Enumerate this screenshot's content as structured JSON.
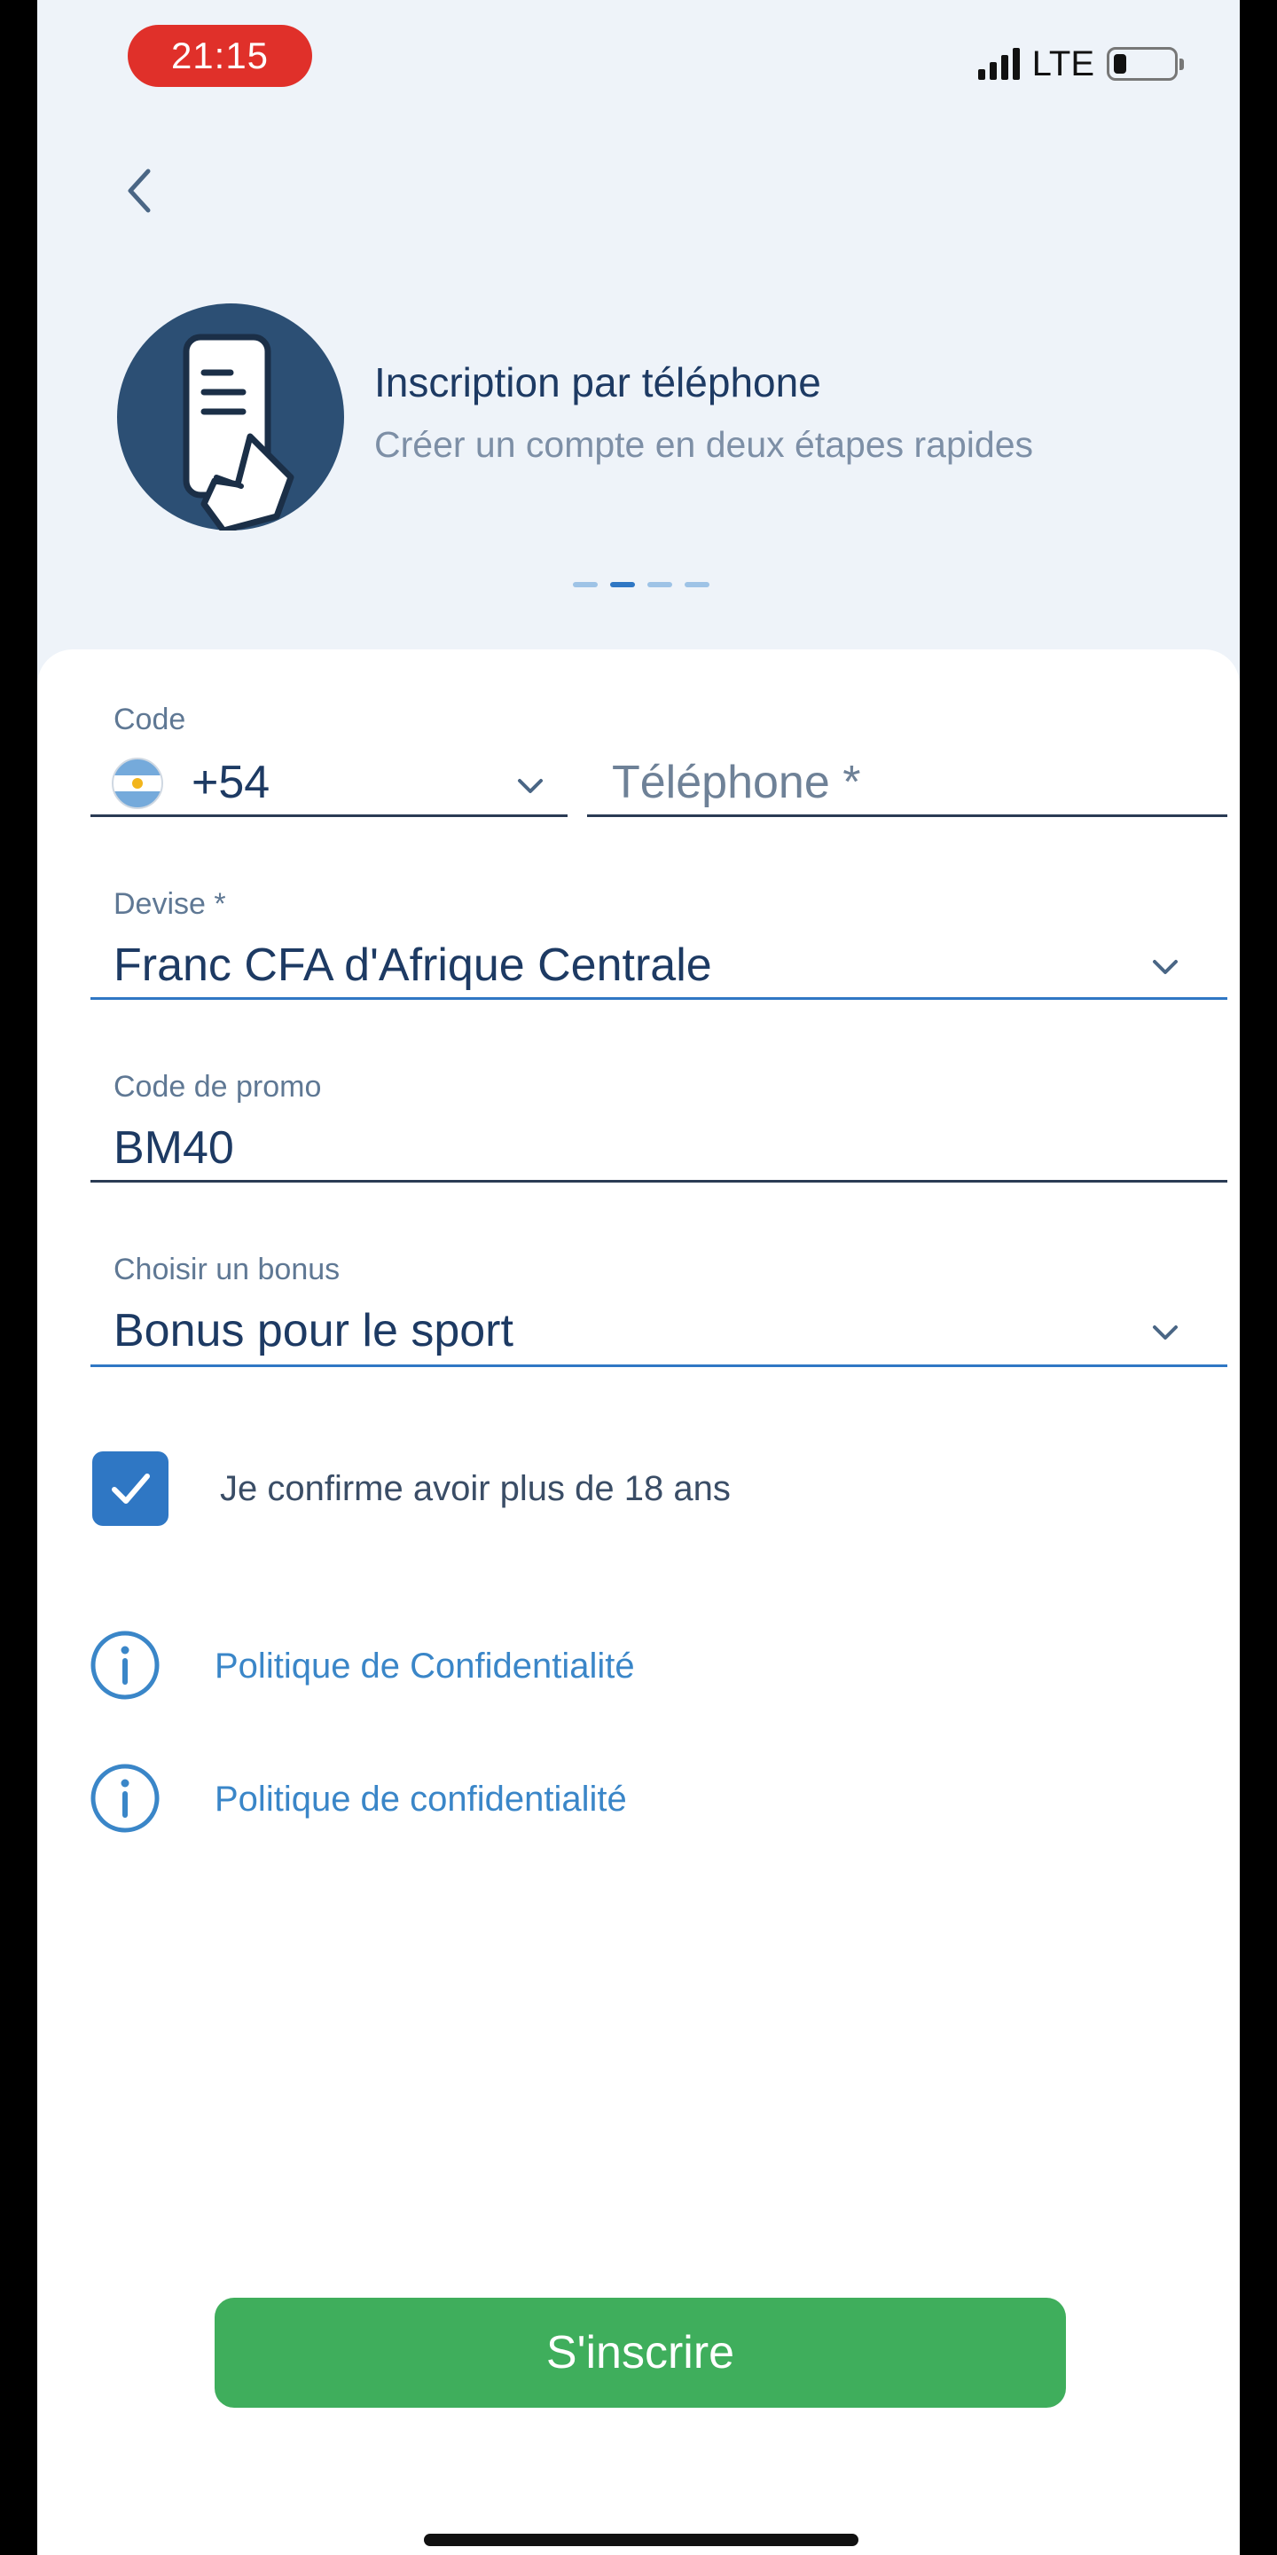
{
  "status_bar": {
    "time": "21:15",
    "network": "LTE",
    "battery_level": 0.2,
    "signal_bars": 4
  },
  "header": {
    "title": "Inscription par téléphone",
    "subtitle": "Créer un compte en deux étapes rapides",
    "steps_total": 4,
    "active_step": 2
  },
  "form": {
    "code": {
      "label": "Code",
      "value": "+54",
      "flag": "argentina-flag-icon"
    },
    "phone": {
      "placeholder": "Téléphone *"
    },
    "currency": {
      "label": "Devise *",
      "value": "Franc CFA d'Afrique Centrale"
    },
    "promo": {
      "label": "Code de promo",
      "value": "BM40"
    },
    "bonus": {
      "label": "Choisir un bonus",
      "value": "Bonus pour le sport"
    },
    "age_confirm": {
      "label": "Je confirme avoir plus de 18 ans",
      "checked": true
    },
    "policies": [
      {
        "label": "Politique de Confidentialité",
        "icon": "info-icon"
      },
      {
        "label": "Politique de confidentialité",
        "icon": "info-icon"
      }
    ],
    "submit_label": "S'inscrire"
  },
  "colors": {
    "accent": "#2f77c4",
    "button": "#3fae5c",
    "time_pill": "#e0302a",
    "text_dark": "#1d3a63",
    "link": "#3a86c8"
  }
}
